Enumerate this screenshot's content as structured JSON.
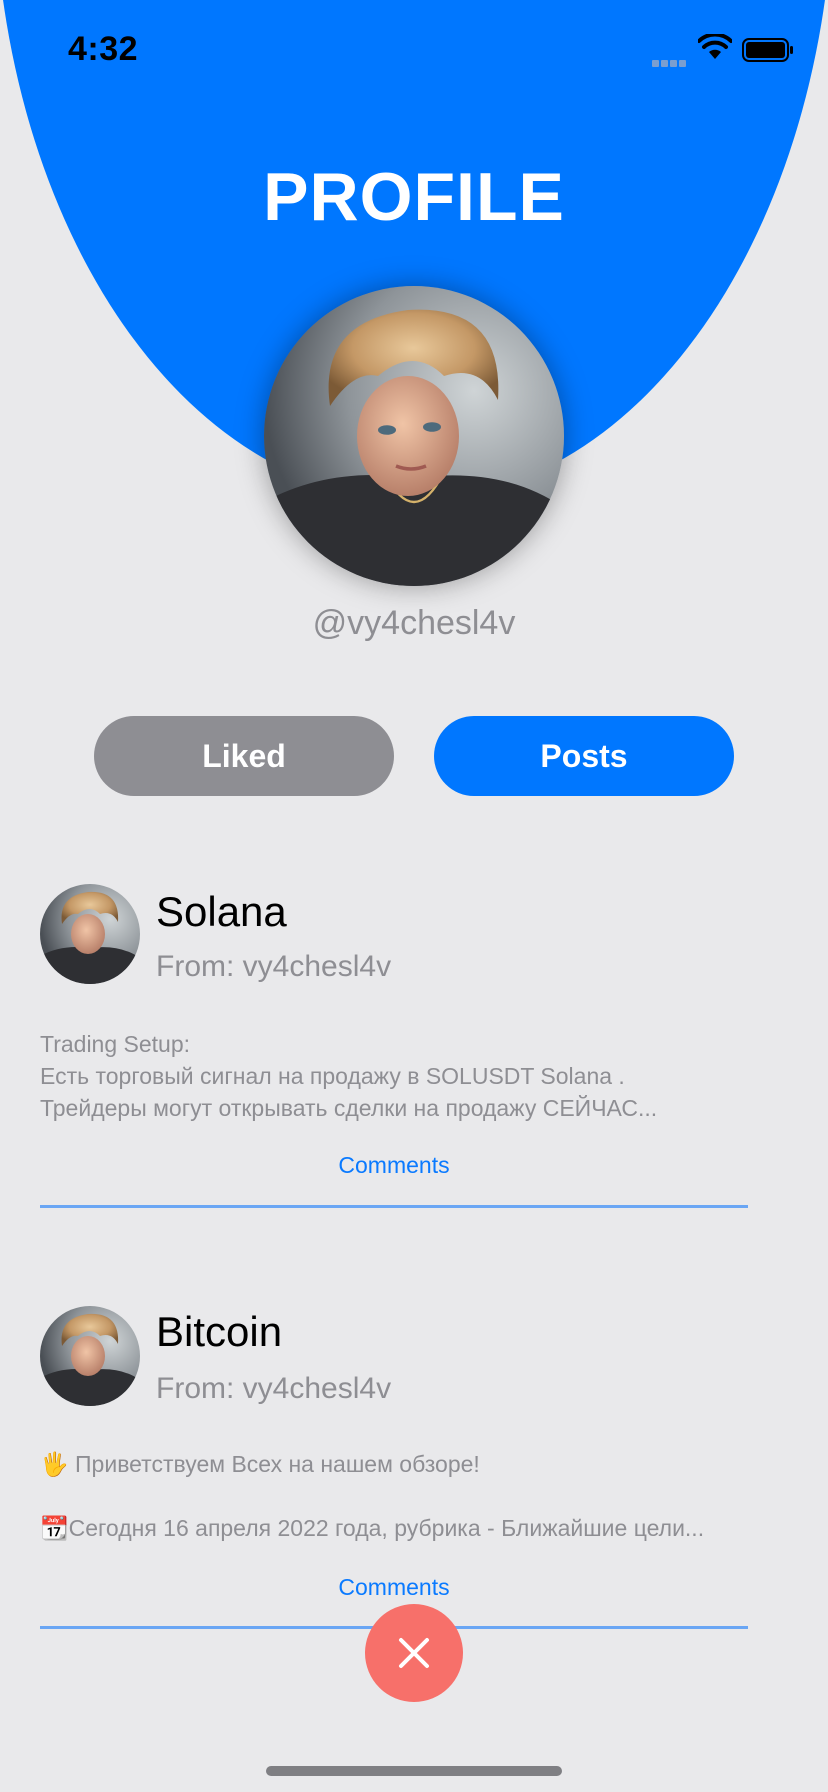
{
  "status_bar": {
    "time": "4:32"
  },
  "header": {
    "title": "PROFILE"
  },
  "profile": {
    "username": "@vy4chesl4v"
  },
  "tabs": {
    "liked": "Liked",
    "posts": "Posts",
    "active": "Posts"
  },
  "posts": [
    {
      "title": "Solana",
      "from": "From: vy4chesl4v",
      "lines": [
        "Trading Setup:",
        "Есть торговый сигнал на продажу в SOLUSDT Solana .",
        "Трейдеры могут открывать сделки на продажу СЕЙЧАС..."
      ],
      "comments_label": "Comments"
    },
    {
      "title": "Bitcoin",
      "from": "From: vy4chesl4v",
      "lines": [
        "🖐 Приветствуем Всех на нашем обзоре!",
        "",
        "📆Сегодня 16 апреля 2022 года, рубрика - Ближайшие цели..."
      ],
      "comments_label": "Comments"
    }
  ],
  "colors": {
    "accent": "#0077ff",
    "background": "#e9e9eb",
    "inactive_tab": "#8e8e93",
    "close_button": "#f7706a",
    "divider": "#6aa6f4"
  },
  "icons": {
    "close": "close-icon",
    "wifi": "wifi-icon",
    "battery": "battery-icon",
    "signal": "signal-icon"
  }
}
